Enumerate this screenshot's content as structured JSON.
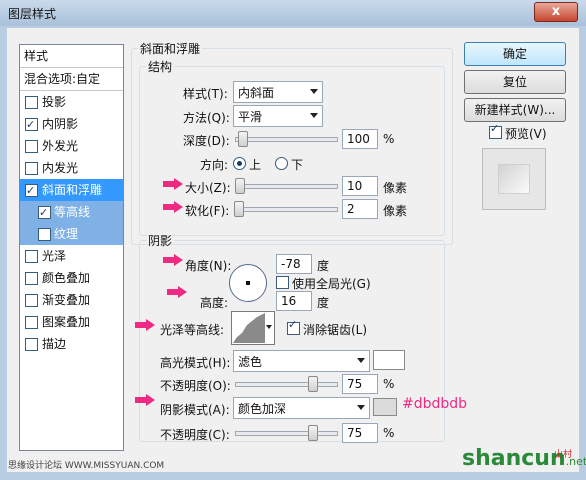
{
  "window": {
    "title": "图层样式",
    "close": "x"
  },
  "styles_list": {
    "header": "样式",
    "blend_options": "混合选项:自定",
    "items": [
      {
        "label": "投影",
        "checked": false
      },
      {
        "label": "内阴影",
        "checked": true
      },
      {
        "label": "外发光",
        "checked": false
      },
      {
        "label": "内发光",
        "checked": false
      },
      {
        "label": "斜面和浮雕",
        "checked": true,
        "selected": true
      },
      {
        "label": "等高线",
        "checked": true,
        "sub": true
      },
      {
        "label": "纹理",
        "checked": false,
        "sub": true
      },
      {
        "label": "光泽",
        "checked": false
      },
      {
        "label": "颜色叠加",
        "checked": false
      },
      {
        "label": "渐变叠加",
        "checked": false
      },
      {
        "label": "图案叠加",
        "checked": false
      },
      {
        "label": "描边",
        "checked": false
      }
    ]
  },
  "bevel": {
    "group_title": "斜面和浮雕",
    "structure_title": "结构",
    "style_label": "样式(T):",
    "style_value": "内斜面",
    "technique_label": "方法(Q):",
    "technique_value": "平滑",
    "depth_label": "深度(D):",
    "depth_value": "100",
    "depth_unit": "%",
    "depth_level": 0.07,
    "direction_label": "方向:",
    "direction_up": "上",
    "direction_down": "下",
    "size_label": "大小(Z):",
    "size_value": "10",
    "size_unit": "像素",
    "size_level": 0.04,
    "soften_label": "软化(F):",
    "soften_value": "2",
    "soften_unit": "像素",
    "soften_level": 0.03
  },
  "shading": {
    "title": "阴影",
    "angle_label": "角度(N):",
    "angle_value": "-78",
    "angle_unit": "度",
    "global_light_label": "使用全局光(G)",
    "altitude_label": "高度:",
    "altitude_value": "16",
    "altitude_unit": "度",
    "gloss_label": "光泽等高线:",
    "antialias_label": "消除锯齿(L)",
    "highlight_mode_label": "高光模式(H):",
    "highlight_mode_value": "滤色",
    "highlight_opacity_label": "不透明度(O):",
    "highlight_opacity_value": "75",
    "highlight_opacity_unit": "%",
    "highlight_opacity_level": 0.75,
    "shadow_mode_label": "阴影模式(A):",
    "shadow_mode_value": "颜色加深",
    "shadow_opacity_label": "不透明度(C):",
    "shadow_opacity_value": "75",
    "shadow_opacity_unit": "%",
    "shadow_opacity_level": 0.75,
    "shadow_color": "#dbdbdb",
    "shadow_color_note": "#dbdbdb",
    "highlight_color": "#ffffff"
  },
  "buttons": {
    "ok": "确定",
    "reset": "复位",
    "new_style": "新建样式(W)...",
    "preview": "预览(V)"
  },
  "watermark": {
    "left": "思缘设计论坛 WWW.MISSYUAN.COM",
    "brand": "shancun",
    "brand_suffix": ".net",
    "brand_cn": "山村"
  },
  "colors": {
    "annotation": "#ef2a82",
    "selection": "#3399ff"
  }
}
